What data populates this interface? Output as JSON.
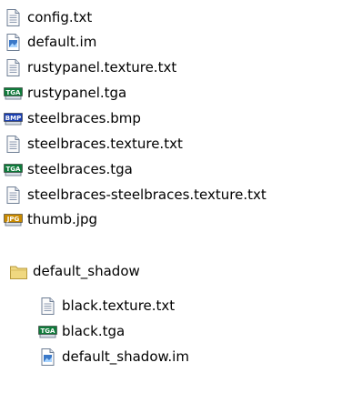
{
  "items": [
    {
      "label": "config.txt",
      "icon": "text-file-icon",
      "level": 0
    },
    {
      "label": "default.im",
      "icon": "image-document-icon",
      "level": 0
    },
    {
      "label": "rustypanel.texture.txt",
      "icon": "text-file-icon",
      "level": 0
    },
    {
      "label": "rustypanel.tga",
      "icon": "tga-file-icon",
      "level": 0
    },
    {
      "label": "steelbraces.bmp",
      "icon": "bmp-file-icon",
      "level": 0
    },
    {
      "label": "steelbraces.texture.txt",
      "icon": "text-file-icon",
      "level": 0
    },
    {
      "label": "steelbraces.tga",
      "icon": "tga-file-icon",
      "level": 0
    },
    {
      "label": "steelbraces-steelbraces.texture.txt",
      "icon": "text-file-icon",
      "level": 0
    },
    {
      "label": "thumb.jpg",
      "icon": "jpg-file-icon",
      "level": 0
    },
    {
      "label": "default_shadow",
      "icon": "folder-icon",
      "level": 0
    },
    {
      "label": "black.texture.txt",
      "icon": "text-file-icon",
      "level": 1
    },
    {
      "label": "black.tga",
      "icon": "tga-file-icon",
      "level": 1
    },
    {
      "label": "default_shadow.im",
      "icon": "image-document-icon",
      "level": 1
    }
  ],
  "icon_badges": {
    "tga": "TGA",
    "bmp": "BMP",
    "jpg": "JPG"
  },
  "colors": {
    "tga_badge": "#0e7a3a",
    "bmp_badge": "#1a3fb0",
    "jpg_badge": "#c98a00",
    "folder": "#f0d880",
    "image_doc": "#3a78c8"
  }
}
